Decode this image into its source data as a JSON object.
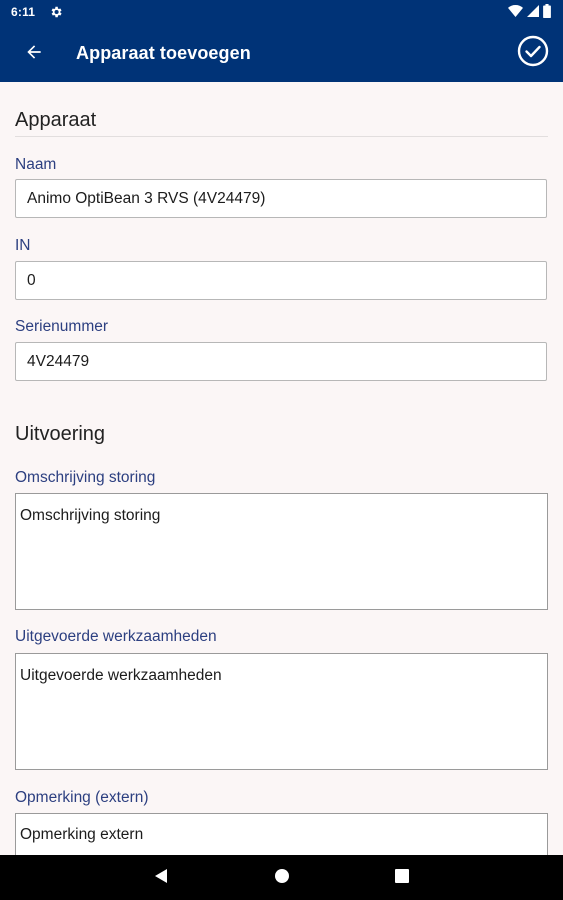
{
  "status_bar": {
    "time": "6:11",
    "settings_icon": "gear-icon",
    "wifi_icon": "wifi-icon",
    "signal_icon": "cellular-signal-icon",
    "battery_icon": "battery-icon"
  },
  "app_bar": {
    "back_icon": "arrow-back-icon",
    "title": "Apparaat toevoegen",
    "confirm_icon": "check-circle-icon",
    "background_color": "#003377"
  },
  "sections": {
    "device": {
      "title": "Apparaat",
      "name_label": "Naam",
      "name_value": "Animo OptiBean 3 RVS (4V24479)",
      "in_label": "IN",
      "in_value": "0",
      "serial_label": "Serienummer",
      "serial_value": "4V24479"
    },
    "execution": {
      "title": "Uitvoering",
      "fault_label": "Omschrijving storing",
      "fault_placeholder": "Omschrijving storing",
      "work_label": "Uitgevoerde werkzaamheden",
      "work_placeholder": "Uitgevoerde werkzaamheden",
      "remark_label": "Opmerking (extern)",
      "remark_placeholder": "Opmerking extern"
    }
  },
  "nav_bar": {
    "back_icon": "nav-back-icon",
    "home_icon": "nav-home-icon",
    "recents_icon": "nav-recents-icon"
  },
  "colors": {
    "label_accent": "#2c3f80",
    "content_background": "#fbf6f6"
  }
}
